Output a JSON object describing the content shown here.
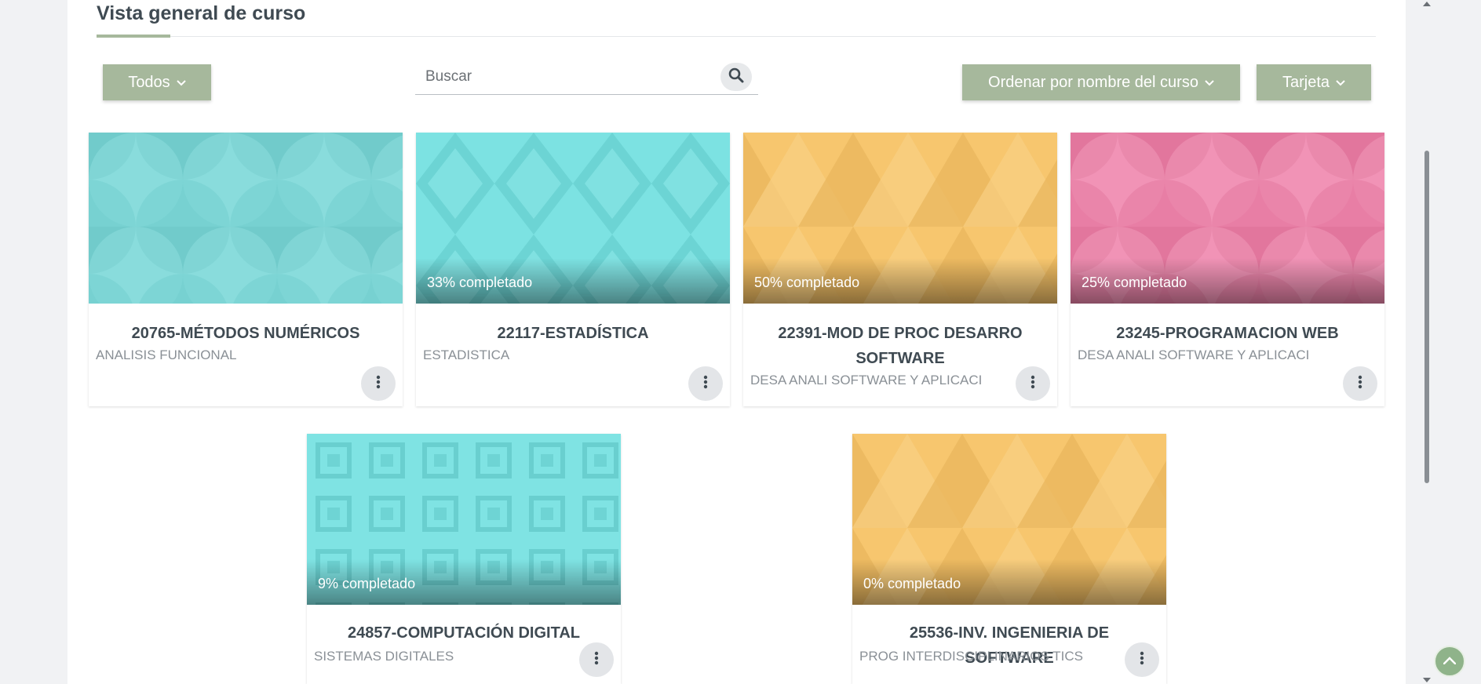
{
  "section": {
    "title": "Vista general de curso"
  },
  "filters": {
    "grouping_label": "Todos",
    "search_placeholder": "Buscar",
    "sort_label": "Ordenar por nombre del curso",
    "view_label": "Tarjeta"
  },
  "colors": {
    "accent": "#a6b89c",
    "teal": "#74dcdc",
    "yellow": "#f8c56c",
    "pink": "#f081a9"
  },
  "courses": [
    {
      "title": "20765-MÉTODOS NUMÉRICOS",
      "category": "ANALISIS FUNCIONAL",
      "progress_text": "",
      "progress": null,
      "pattern": "circles-teal"
    },
    {
      "title": "22117-ESTADÍSTICA",
      "category": "ESTADISTICA",
      "progress_text": "33% completado",
      "progress": 33,
      "pattern": "diamonds-teal"
    },
    {
      "title": "22391-MOD DE PROC DESARRO SOFTWARE",
      "category": "DESA ANALI SOFTWARE Y APLICACI",
      "progress_text": "50% completado",
      "progress": 50,
      "pattern": "triangles-yellow"
    },
    {
      "title": "23245-PROGRAMACION WEB",
      "category": "DESA ANALI SOFTWARE Y APLICACI",
      "progress_text": "25% completado",
      "progress": 25,
      "pattern": "circles-pink"
    },
    {
      "title": "24857-COMPUTACIÓN DIGITAL",
      "category": "SISTEMAS DIGITALES",
      "progress_text": "9% completado",
      "progress": 9,
      "pattern": "squares-teal"
    },
    {
      "title": "25536-INV. INGENIERIA DE SOFTWARE",
      "category": "PROG INTERDISCIPLINARIOS TICS",
      "progress_text": "0% completado",
      "progress": 0,
      "pattern": "triangles-yellow"
    }
  ],
  "icons": {
    "search": "search-icon",
    "chevron": "chevron-down-icon",
    "kebab": "kebab-menu-icon",
    "back_to_top": "chevron-up-icon"
  }
}
